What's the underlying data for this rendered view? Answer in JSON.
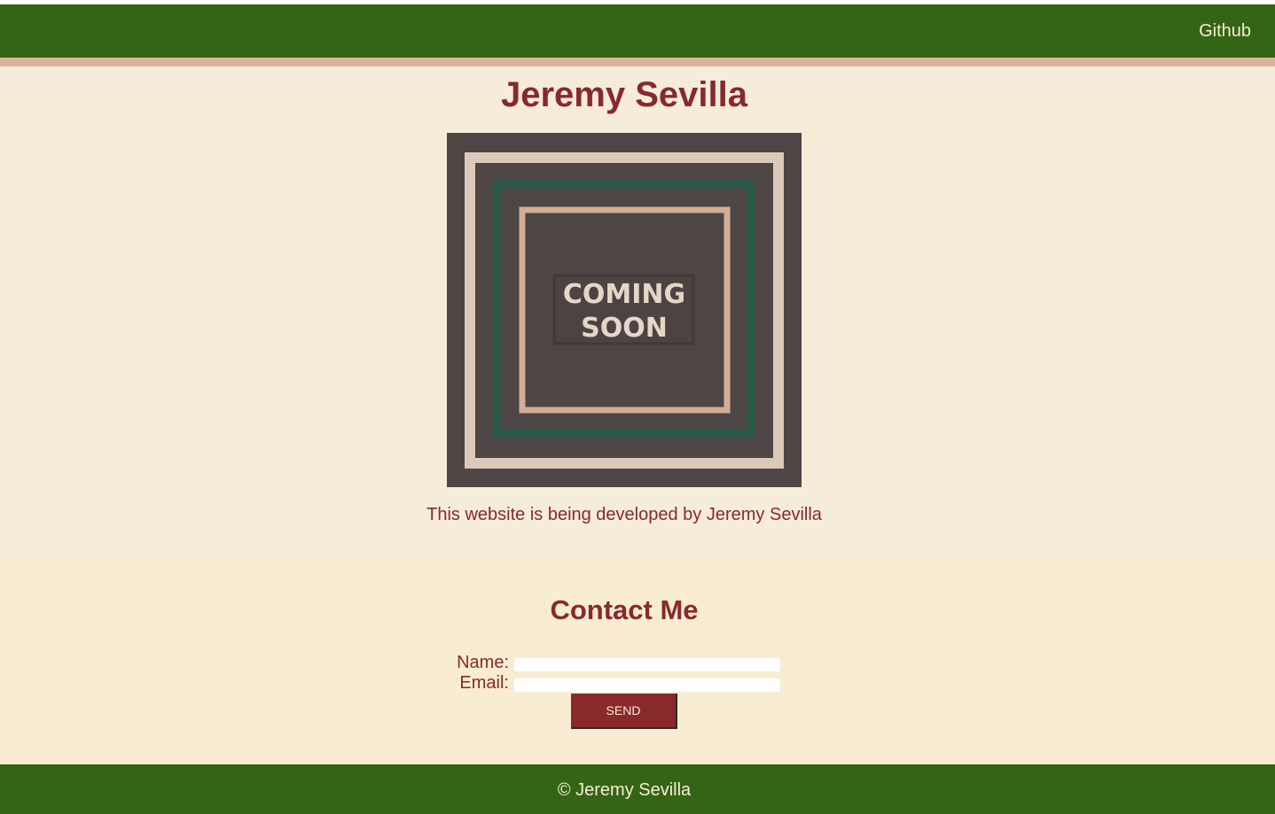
{
  "nav": {
    "github_label": "Github"
  },
  "hero": {
    "title": "Jeremy Sevilla",
    "image_text_line1": "COMING",
    "image_text_line2": "SOON",
    "caption": "This website is being developed by Jeremy Sevilla"
  },
  "contact": {
    "heading": "Contact Me",
    "name_label": "Name:",
    "name_value": "",
    "email_label": "Email:",
    "email_value": "",
    "send_label": "SEND"
  },
  "footer": {
    "text": "© Jeremy Sevilla"
  },
  "colors": {
    "nav_green": "#346514",
    "accent_red": "#88292b",
    "cream": "#f6ecda",
    "tan": "#d9b29d",
    "graphic_dark": "#4d4644",
    "graphic_green": "#29594a"
  }
}
